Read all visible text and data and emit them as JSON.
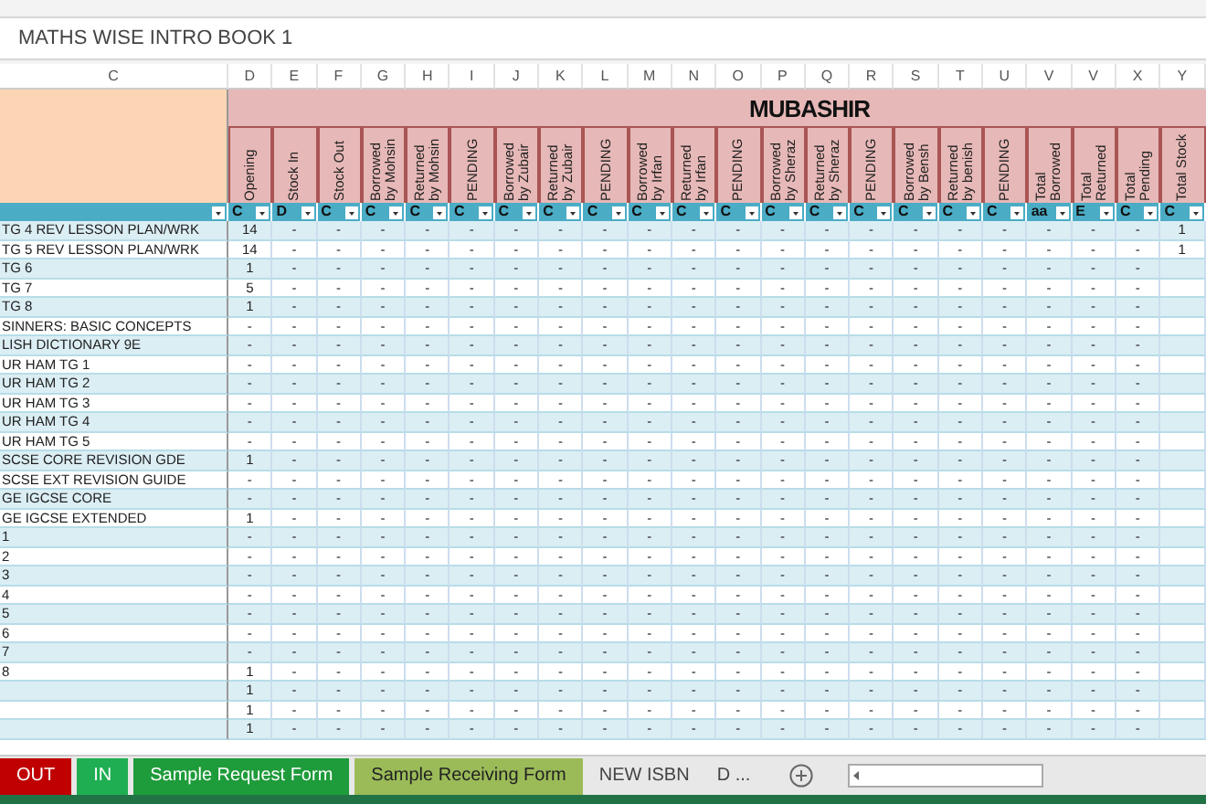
{
  "formula_bar": {
    "value": "MATHS WISE INTRO BOOK 1"
  },
  "column_letters": [
    "C",
    "D",
    "E",
    "F",
    "G",
    "H",
    "I",
    "J",
    "K",
    "L",
    "M",
    "N",
    "O",
    "P",
    "Q",
    "R",
    "S",
    "T",
    "U",
    "V",
    "V",
    "X",
    "Y"
  ],
  "group_title": "MUBASHIR",
  "headers": [
    "Opening",
    "Stock In",
    "Stock Out",
    "Borrowed by Mohsin",
    "Returned by Mohsin",
    "PENDING",
    "Borrowed by Zubair",
    "Returned by Zubair",
    "PENDING",
    "Borrowed by Irfan",
    "Returned by Irfan",
    "PENDING",
    "Borrowed by Sheraz",
    "Returned by Sheraz",
    "PENDING",
    "Borrowed by Bensh",
    "Returned by benish",
    "PENDING",
    "Total Borrowed",
    "Total Returned",
    "Total Pending",
    "Total Stock"
  ],
  "filters": [
    "C",
    "D",
    "C",
    "C",
    "C",
    "C",
    "C",
    "C",
    "C",
    "C",
    "C",
    "C",
    "C",
    "C",
    "C",
    "C",
    "C",
    "C",
    "aa",
    "E",
    "C",
    "C"
  ],
  "rows": [
    {
      "label": "TG 4 REV LESSON PLAN/WRK",
      "values": [
        "14",
        "-",
        "-",
        "-",
        "-",
        "-",
        "-",
        "-",
        "-",
        "-",
        "-",
        "-",
        "-",
        "-",
        "-",
        "-",
        "-",
        "-",
        "-",
        "-",
        "-",
        "1"
      ]
    },
    {
      "label": "TG 5 REV LESSON PLAN/WRK",
      "values": [
        "14",
        "-",
        "-",
        "-",
        "-",
        "-",
        "-",
        "-",
        "-",
        "-",
        "-",
        "-",
        "-",
        "-",
        "-",
        "-",
        "-",
        "-",
        "-",
        "-",
        "-",
        "1"
      ]
    },
    {
      "label": "TG 6",
      "values": [
        "1",
        "-",
        "-",
        "-",
        "-",
        "-",
        "-",
        "-",
        "-",
        "-",
        "-",
        "-",
        "-",
        "-",
        "-",
        "-",
        "-",
        "-",
        "-",
        "-",
        "-"
      ]
    },
    {
      "label": "TG 7",
      "values": [
        "5",
        "-",
        "-",
        "-",
        "-",
        "-",
        "-",
        "-",
        "-",
        "-",
        "-",
        "-",
        "-",
        "-",
        "-",
        "-",
        "-",
        "-",
        "-",
        "-",
        "-"
      ]
    },
    {
      "label": "TG 8",
      "values": [
        "1",
        "-",
        "-",
        "-",
        "-",
        "-",
        "-",
        "-",
        "-",
        "-",
        "-",
        "-",
        "-",
        "-",
        "-",
        "-",
        "-",
        "-",
        "-",
        "-",
        "-"
      ]
    },
    {
      "label": "SINNERS: BASIC CONCEPTS",
      "values": [
        "-",
        "-",
        "-",
        "-",
        "-",
        "-",
        "-",
        "-",
        "-",
        "-",
        "-",
        "-",
        "-",
        "-",
        "-",
        "-",
        "-",
        "-",
        "-",
        "-",
        "-"
      ]
    },
    {
      "label": "LISH DICTIONARY 9E",
      "values": [
        "-",
        "-",
        "-",
        "-",
        "-",
        "-",
        "-",
        "-",
        "-",
        "-",
        "-",
        "-",
        "-",
        "-",
        "-",
        "-",
        "-",
        "-",
        "-",
        "-",
        "-"
      ]
    },
    {
      "label": "UR HAM TG 1",
      "values": [
        "-",
        "-",
        "-",
        "-",
        "-",
        "-",
        "-",
        "-",
        "-",
        "-",
        "-",
        "-",
        "-",
        "-",
        "-",
        "-",
        "-",
        "-",
        "-",
        "-",
        "-"
      ]
    },
    {
      "label": "UR HAM TG 2",
      "values": [
        "-",
        "-",
        "-",
        "-",
        "-",
        "-",
        "-",
        "-",
        "-",
        "-",
        "-",
        "-",
        "-",
        "-",
        "-",
        "-",
        "-",
        "-",
        "-",
        "-",
        "-"
      ]
    },
    {
      "label": "UR HAM TG 3",
      "values": [
        "-",
        "-",
        "-",
        "-",
        "-",
        "-",
        "-",
        "-",
        "-",
        "-",
        "-",
        "-",
        "-",
        "-",
        "-",
        "-",
        "-",
        "-",
        "-",
        "-",
        "-"
      ]
    },
    {
      "label": "UR HAM TG 4",
      "values": [
        "-",
        "-",
        "-",
        "-",
        "-",
        "-",
        "-",
        "-",
        "-",
        "-",
        "-",
        "-",
        "-",
        "-",
        "-",
        "-",
        "-",
        "-",
        "-",
        "-",
        "-"
      ]
    },
    {
      "label": "UR HAM TG 5",
      "values": [
        "-",
        "-",
        "-",
        "-",
        "-",
        "-",
        "-",
        "-",
        "-",
        "-",
        "-",
        "-",
        "-",
        "-",
        "-",
        "-",
        "-",
        "-",
        "-",
        "-",
        "-"
      ]
    },
    {
      "label": "SCSE CORE REVISION GDE",
      "values": [
        "1",
        "-",
        "-",
        "-",
        "-",
        "-",
        "-",
        "-",
        "-",
        "-",
        "-",
        "-",
        "-",
        "-",
        "-",
        "-",
        "-",
        "-",
        "-",
        "-",
        "-"
      ]
    },
    {
      "label": "SCSE EXT REVISION GUIDE",
      "values": [
        "-",
        "-",
        "-",
        "-",
        "-",
        "-",
        "-",
        "-",
        "-",
        "-",
        "-",
        "-",
        "-",
        "-",
        "-",
        "-",
        "-",
        "-",
        "-",
        "-",
        "-"
      ]
    },
    {
      "label": "GE IGCSE CORE",
      "values": [
        "-",
        "-",
        "-",
        "-",
        "-",
        "-",
        "-",
        "-",
        "-",
        "-",
        "-",
        "-",
        "-",
        "-",
        "-",
        "-",
        "-",
        "-",
        "-",
        "-",
        "-"
      ]
    },
    {
      "label": "GE IGCSE EXTENDED",
      "values": [
        "1",
        "-",
        "-",
        "-",
        "-",
        "-",
        "-",
        "-",
        "-",
        "-",
        "-",
        "-",
        "-",
        "-",
        "-",
        "-",
        "-",
        "-",
        "-",
        "-",
        "-"
      ]
    },
    {
      "label": "1",
      "values": [
        "-",
        "-",
        "-",
        "-",
        "-",
        "-",
        "-",
        "-",
        "-",
        "-",
        "-",
        "-",
        "-",
        "-",
        "-",
        "-",
        "-",
        "-",
        "-",
        "-",
        "-"
      ]
    },
    {
      "label": "2",
      "values": [
        "-",
        "-",
        "-",
        "-",
        "-",
        "-",
        "-",
        "-",
        "-",
        "-",
        "-",
        "-",
        "-",
        "-",
        "-",
        "-",
        "-",
        "-",
        "-",
        "-",
        "-"
      ]
    },
    {
      "label": "3",
      "values": [
        "-",
        "-",
        "-",
        "-",
        "-",
        "-",
        "-",
        "-",
        "-",
        "-",
        "-",
        "-",
        "-",
        "-",
        "-",
        "-",
        "-",
        "-",
        "-",
        "-",
        "-"
      ]
    },
    {
      "label": "4",
      "values": [
        "-",
        "-",
        "-",
        "-",
        "-",
        "-",
        "-",
        "-",
        "-",
        "-",
        "-",
        "-",
        "-",
        "-",
        "-",
        "-",
        "-",
        "-",
        "-",
        "-",
        "-"
      ]
    },
    {
      "label": "5",
      "values": [
        "-",
        "-",
        "-",
        "-",
        "-",
        "-",
        "-",
        "-",
        "-",
        "-",
        "-",
        "-",
        "-",
        "-",
        "-",
        "-",
        "-",
        "-",
        "-",
        "-",
        "-"
      ]
    },
    {
      "label": "6",
      "values": [
        "-",
        "-",
        "-",
        "-",
        "-",
        "-",
        "-",
        "-",
        "-",
        "-",
        "-",
        "-",
        "-",
        "-",
        "-",
        "-",
        "-",
        "-",
        "-",
        "-",
        "-"
      ]
    },
    {
      "label": "7",
      "values": [
        "-",
        "-",
        "-",
        "-",
        "-",
        "-",
        "-",
        "-",
        "-",
        "-",
        "-",
        "-",
        "-",
        "-",
        "-",
        "-",
        "-",
        "-",
        "-",
        "-",
        "-"
      ]
    },
    {
      "label": "8",
      "values": [
        "1",
        "-",
        "-",
        "-",
        "-",
        "-",
        "-",
        "-",
        "-",
        "-",
        "-",
        "-",
        "-",
        "-",
        "-",
        "-",
        "-",
        "-",
        "-",
        "-",
        "-"
      ]
    },
    {
      "values": [
        "1",
        "-",
        "-",
        "-",
        "-",
        "-",
        "-",
        "-",
        "-",
        "-",
        "-",
        "-",
        "-",
        "-",
        "-",
        "-",
        "-",
        "-",
        "-",
        "-",
        "-"
      ]
    },
    {
      "values": [
        "1",
        "-",
        "-",
        "-",
        "-",
        "-",
        "-",
        "-",
        "-",
        "-",
        "-",
        "-",
        "-",
        "-",
        "-",
        "-",
        "-",
        "-",
        "-",
        "-",
        "-"
      ]
    },
    {
      "values": [
        "1",
        "-",
        "-",
        "-",
        "-",
        "-",
        "-",
        "-",
        "-",
        "-",
        "-",
        "-",
        "-",
        "-",
        "-",
        "-",
        "-",
        "-",
        "-",
        "-",
        "-"
      ]
    }
  ],
  "sheet_tabs": [
    {
      "label": "OUT",
      "color": "#c00000"
    },
    {
      "label": "IN",
      "color": "#1fae52"
    },
    {
      "label": "Sample Request Form",
      "color": "#1e9b3a"
    },
    {
      "label": "Sample Receiving Form",
      "color": "#9bbb59"
    },
    {
      "label": "NEW ISBN"
    },
    {
      "label": "D ..."
    }
  ]
}
